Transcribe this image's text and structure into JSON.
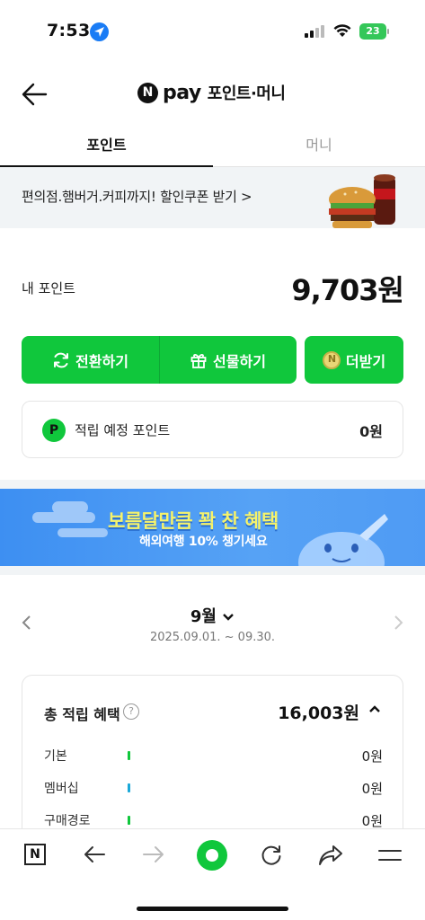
{
  "status_bar": {
    "time": "7:53",
    "battery": "23"
  },
  "header": {
    "logo_letter": "N",
    "pay": "pay",
    "title": "포인트·머니"
  },
  "tabs": [
    {
      "label": "포인트",
      "active": true
    },
    {
      "label": "머니",
      "active": false
    }
  ],
  "promo": {
    "text": "편의점.햄버거.커피까지! 할인쿠폰 받기 >"
  },
  "points": {
    "label": "내 포인트",
    "value": "9,703원",
    "buttons": {
      "convert": "전환하기",
      "gift": "선물하기",
      "more": "더받기"
    },
    "pending": {
      "icon_letter": "P",
      "label": "적립 예정 포인트",
      "value": "0원"
    }
  },
  "event_banner": {
    "title": "보름달만큼 꽉 찬 혜택",
    "subtitle": "해외여행 10% 챙기세요"
  },
  "month": {
    "label": "9월",
    "range": "2025.09.01. ~ 09.30."
  },
  "benefits": {
    "title": "총 적립 혜택",
    "total": "16,003원",
    "help": "?",
    "rows": [
      {
        "label": "기본",
        "value": "0원",
        "color": "#10c73c"
      },
      {
        "label": "멤버십",
        "value": "0원",
        "color": "#1aa8d8"
      },
      {
        "label": "구매경로",
        "value": "0원",
        "color": "#10c73c"
      }
    ]
  },
  "toolbar": {
    "n_letter": "N"
  },
  "colors": {
    "brand_green": "#10c73c",
    "banner_blue": "#4f9bf4"
  }
}
